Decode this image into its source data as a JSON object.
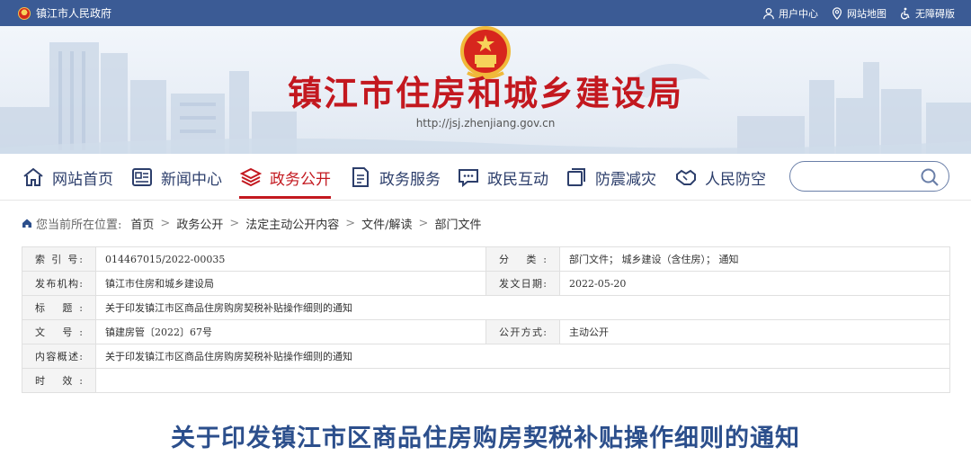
{
  "topbar": {
    "site_name": "镇江市人民政府",
    "links": [
      {
        "label": "用户中心",
        "icon": "user-icon"
      },
      {
        "label": "网站地图",
        "icon": "map-pin-icon"
      },
      {
        "label": "无障碍版",
        "icon": "accessibility-icon"
      }
    ]
  },
  "banner": {
    "title": "镇江市住房和城乡建设局",
    "url": "http://jsj.zhenjiang.gov.cn"
  },
  "nav": {
    "items": [
      {
        "label": "网站首页",
        "icon": "home-icon",
        "active": false
      },
      {
        "label": "新闻中心",
        "icon": "newspaper-icon",
        "active": false
      },
      {
        "label": "政务公开",
        "icon": "layers-icon",
        "active": true
      },
      {
        "label": "政务服务",
        "icon": "document-icon",
        "active": false
      },
      {
        "label": "政民互动",
        "icon": "chat-icon",
        "active": false
      },
      {
        "label": "防震减灾",
        "icon": "square-stack-icon",
        "active": false
      },
      {
        "label": "人民防空",
        "icon": "handshake-icon",
        "active": false
      }
    ],
    "search_placeholder": ""
  },
  "breadcrumb": {
    "lead": "您当前所在位置:",
    "items": [
      "首页",
      "政务公开",
      "法定主动公开内容",
      "文件/解读",
      "部门文件"
    ]
  },
  "info": {
    "index_label": "索 引 号:",
    "index_value": "014467015/2022-00035",
    "category_label": "分 类:",
    "category_value": "部门文件；  城乡建设（含住房）；  通知",
    "publisher_label": "发布机构:",
    "publisher_value": "镇江市住房和城乡建设局",
    "date_label": "发文日期:",
    "date_value": "2022-05-20",
    "title_label": "标 题:",
    "title_value": "关于印发镇江市区商品住房购房契税补贴操作细则的通知",
    "docno_label": "文 号:",
    "docno_value": "镇建房管〔2022〕67号",
    "disclosure_label": "公开方式:",
    "disclosure_value": "主动公开",
    "summary_label": "内容概述:",
    "summary_value": "关于印发镇江市区商品住房购房契税补贴操作细则的通知",
    "validity_label": "时 效:",
    "validity_value": ""
  },
  "document": {
    "title": "关于印发镇江市区商品住房购房契税补贴操作细则的通知"
  },
  "colors": {
    "topbar": "#3b5b95",
    "accent": "#c3181f",
    "nav_text": "#2c3e6b",
    "doc_title": "#2c4f8c"
  }
}
